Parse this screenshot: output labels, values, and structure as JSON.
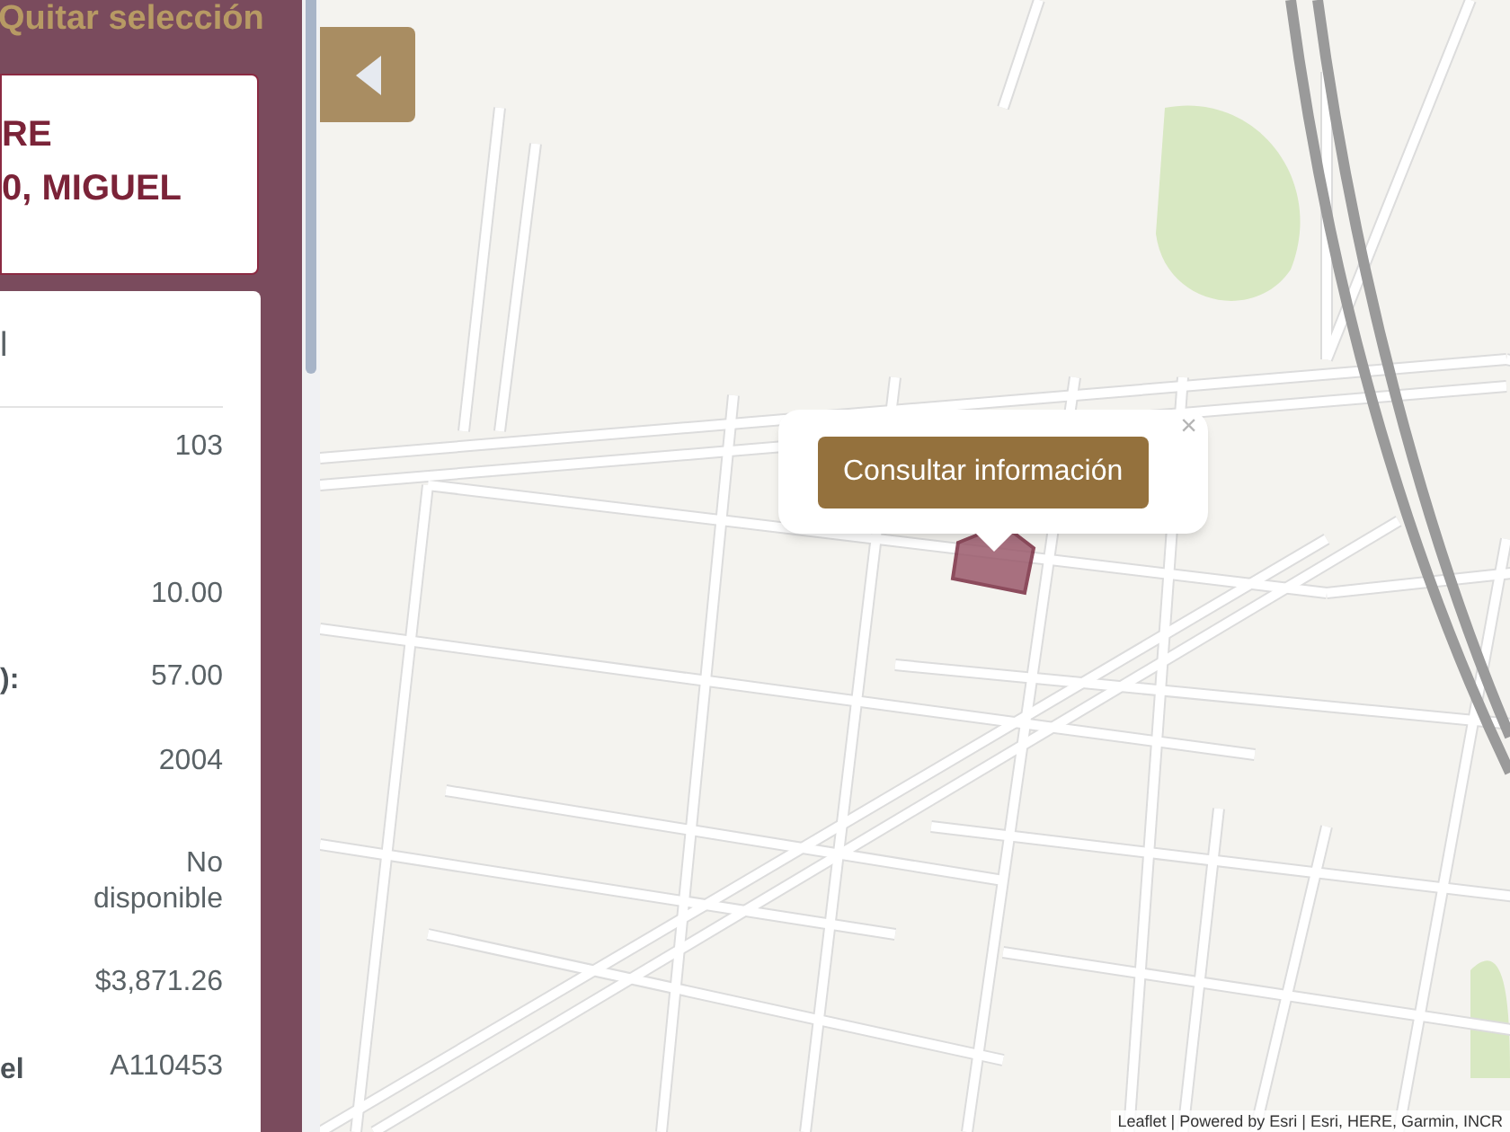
{
  "sidebar": {
    "clear_selection": "Quitar selección",
    "name_lines": [
      "RE",
      "0, MIGUEL"
    ],
    "info_header": "l",
    "info_rows": [
      {
        "label": "",
        "value": "103"
      },
      {
        "label": "",
        "value": "10.00"
      },
      {
        "label": "):",
        "value": "57.00"
      },
      {
        "label": "",
        "value": "2004"
      },
      {
        "label": "",
        "value": "No disponible"
      },
      {
        "label": "",
        "value": "$3,871.26"
      },
      {
        "label": "el",
        "value": "A110453"
      }
    ]
  },
  "map": {
    "popup": {
      "button": "Consultar información",
      "close": "×"
    },
    "attribution": "Leaflet | Powered by Esri | Esri, HERE, Garmin, INCR"
  }
}
